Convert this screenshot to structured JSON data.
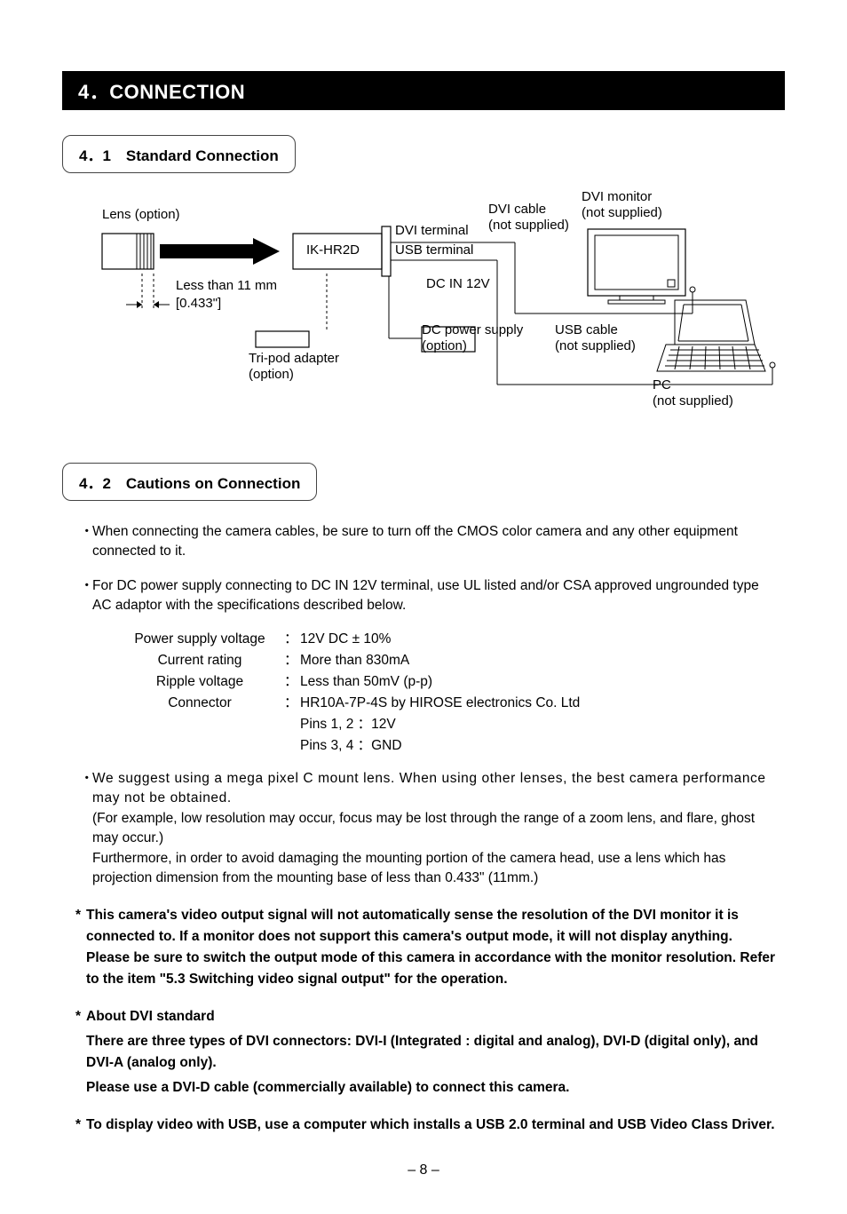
{
  "section": {
    "banner": "4．CONNECTION"
  },
  "sub1": {
    "heading": "4．1　Standard Connection"
  },
  "diagram": {
    "lens": "Lens (option)",
    "lessThan": "Less than 11 mm",
    "lessThanInches": "[0.433\"]",
    "ikhr2d": "IK-HR2D",
    "tripod1": "Tri-pod adapter",
    "tripod2": "(option)",
    "dviTerm": "DVI terminal",
    "usbTerm": "USB terminal",
    "dcin": "DC IN 12V",
    "dcPower1": "DC power supply",
    "dcPower2": "(option)",
    "dviCable1": "DVI cable",
    "dviCable2": "(not supplied)",
    "dviMonitor1": "DVI monitor",
    "dviMonitor2": "(not supplied)",
    "usbCable1": "USB cable",
    "usbCable2": "(not supplied)",
    "pc1": "PC",
    "pc2": "(not supplied)"
  },
  "sub2": {
    "heading": "4．2　Cautions on Connection"
  },
  "cautions": {
    "dot": "・",
    "b1": "When connecting the camera cables, be sure to turn off the CMOS color camera and any other equipment connected to it.",
    "b2": "For DC power supply connecting to DC IN 12V terminal, use UL listed and/or CSA approved ungrounded type AC adaptor with the specifications described below.",
    "spec": {
      "r1l": "Power supply voltage",
      "r1v": "12V DC ± 10%",
      "r2l": "Current rating",
      "r2v": "More than 830mA",
      "r3l": "Ripple voltage",
      "r3v": "Less than 50mV (p-p)",
      "r4l": "Connector",
      "r4v": "HR10A-7P-4S by HIROSE electronics Co. Ltd",
      "r5v": "Pins 1, 2  ：12V",
      "r6v": "Pins 3, 4  ：GND"
    },
    "b3a": "We suggest using a mega pixel C mount lens. When using other lenses, the best camera performance may not be obtained.",
    "b3b": "(For example, low resolution may occur, focus may be lost through the range of a zoom lens, and flare, ghost may occur.)",
    "b3c": "Furthermore, in order to avoid damaging the mounting portion of the camera head, use a lens which has projection dimension from the mounting base of less than  0.433\" (11mm.)"
  },
  "notes": {
    "star": "*",
    "n1": "This camera's video output signal will not automatically sense the resolution of the DVI monitor it is connected to. If a monitor does not support this camera's output mode, it will not display anything. Please be sure to switch the output mode of this camera in accordance with the monitor resolution. Refer to the item \"5.3 Switching video signal output\" for the operation.",
    "n2t": "About DVI standard",
    "n2a": "There are three types of DVI connectors: DVI-I (Integrated : digital and analog), DVI-D (digital only), and DVI-A (analog only).",
    "n2b": "Please use a DVI-D cable (commercially available) to connect this camera.",
    "n3": "To display video with USB, use a computer which installs a USB 2.0 terminal and USB Video Class Driver."
  },
  "pageNumber": "8"
}
